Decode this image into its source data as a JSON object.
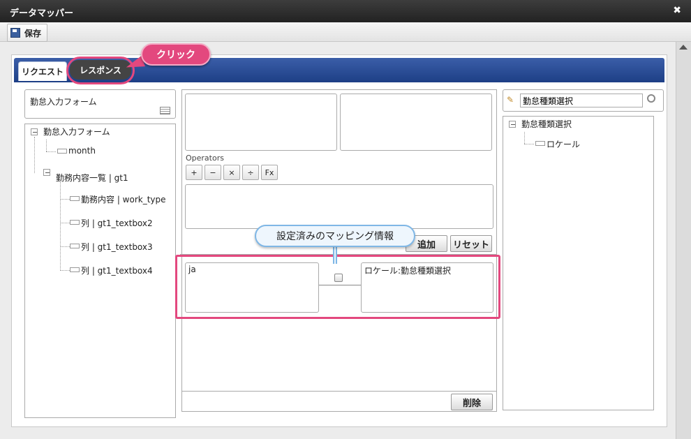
{
  "window": {
    "title": "データマッパー",
    "close_glyph": "✖"
  },
  "toolbar": {
    "save_label": "保存",
    "save_icon": "floppy-icon"
  },
  "tabs": [
    {
      "label": "リクエスト",
      "active": true
    },
    {
      "label": "レスポンス",
      "active": false
    }
  ],
  "callouts": {
    "click": "クリック",
    "mapping_info": "設定済みのマッピング情報"
  },
  "left_panel": {
    "form_name": "勤怠入力フォーム",
    "tree": {
      "root": "勤怠入力フォーム",
      "items": [
        "month",
        "勤務内容一覧 | gt1"
      ],
      "subitems": [
        "勤務内容 | work_type",
        "列 | gt1_textbox2",
        "列 | gt1_textbox3",
        "列 | gt1_textbox4"
      ]
    }
  },
  "center": {
    "operators_label": "Operators",
    "operators": [
      "+",
      "−",
      "×",
      "÷",
      "Fx"
    ],
    "add_label": "追加",
    "reset_label": "リセット",
    "mapping": {
      "source": "ja",
      "target": "ロケール:勤怠種類選択"
    },
    "delete_label": "削除"
  },
  "right_panel": {
    "search_value": "勤怠種類選択",
    "tree": {
      "root": "勤怠種類選択",
      "child": "ロケール"
    }
  },
  "colors": {
    "accent": "#e3487e",
    "tabbar": "#2a4b92",
    "bubble_border": "#7fb7e6"
  }
}
